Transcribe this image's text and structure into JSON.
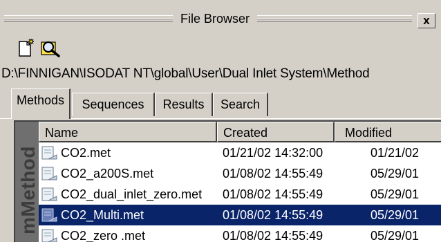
{
  "window": {
    "title": "File Browser",
    "close_label": "x"
  },
  "toolbar": {
    "icons": [
      "new-file-icon",
      "search-icon"
    ]
  },
  "path": "D:\\FINNIGAN\\ISODAT NT\\global\\User\\Dual Inlet System\\Method",
  "tabs": [
    {
      "label": "Methods",
      "active": true
    },
    {
      "label": "Sequences",
      "active": false
    },
    {
      "label": "Results",
      "active": false
    },
    {
      "label": "Search",
      "active": false
    }
  ],
  "side_label": "mMethod",
  "table": {
    "columns": [
      "Name",
      "Created",
      "Modified"
    ],
    "rows": [
      {
        "name": "CO2.met",
        "created": "01/21/02 14:32:00",
        "modified": "01/21/02",
        "selected": false
      },
      {
        "name": "CO2_a200S.met",
        "created": "01/08/02 14:55:49",
        "modified": "05/29/01",
        "selected": false
      },
      {
        "name": "CO2_dual_inlet_zero.met",
        "created": "01/08/02 14:55:49",
        "modified": "05/29/01",
        "selected": false
      },
      {
        "name": "CO2_Multi.met",
        "created": "01/08/02 14:55:49",
        "modified": "05/29/01",
        "selected": true
      },
      {
        "name": "CO2_zero .met",
        "created": "01/08/02 14:55:49",
        "modified": "05/29/01",
        "selected": false
      }
    ]
  },
  "colors": {
    "selection": "#0a246a",
    "face": "#d4d0c8"
  }
}
